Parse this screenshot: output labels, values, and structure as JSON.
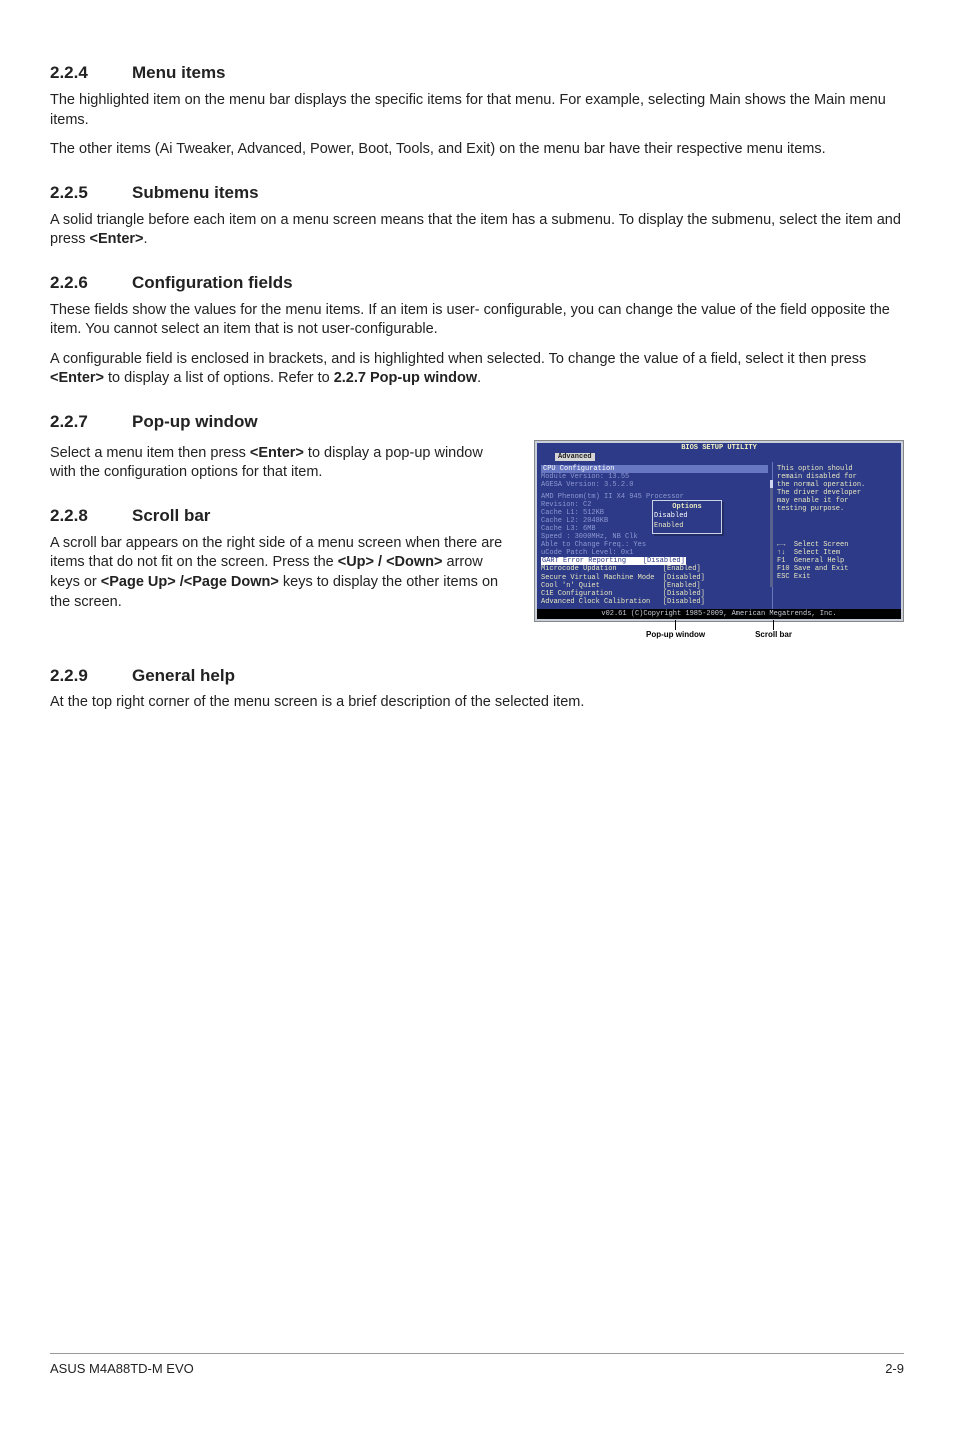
{
  "sections": {
    "s224": {
      "num": "2.2.4",
      "title": "Menu items",
      "p1": "The highlighted item on the menu bar displays the specific items for that menu. For example, selecting Main shows the Main menu items.",
      "p2": "The other items (Ai Tweaker, Advanced, Power, Boot, Tools, and Exit) on the menu bar have their respective menu items."
    },
    "s225": {
      "num": "2.2.5",
      "title": "Submenu items",
      "p1_a": "A solid triangle before each item on a menu screen means that the item has a submenu. To display the submenu, select the item and press ",
      "p1_b": "<Enter>",
      "p1_c": "."
    },
    "s226": {
      "num": "2.2.6",
      "title": "Configuration fields",
      "p1": "These fields show the values for the menu items. If an item is user- configurable, you can change the value of the field opposite the item. You cannot select an item that is not user-configurable.",
      "p2_a": "A configurable field is enclosed in brackets, and is highlighted when selected. To change the value of a field, select it then press ",
      "p2_b": "<Enter>",
      "p2_c": " to display a list of options. Refer to ",
      "p2_d": "2.2.7 Pop-up window",
      "p2_e": "."
    },
    "s227": {
      "num": "2.2.7",
      "title": "Pop-up window",
      "p1_a": "Select a menu item then press ",
      "p1_b": "<Enter>",
      "p1_c": " to display a pop-up window with the configuration options for that item."
    },
    "s228": {
      "num": "2.2.8",
      "title": "Scroll bar",
      "p1_a": "A scroll bar appears on the right side of a menu screen when there are items that do not fit on the screen. Press the ",
      "p1_b": "<Up> / <Down>",
      "p1_c": " arrow keys or ",
      "p1_d": "<Page Up> /<Page Down>",
      "p1_e": " keys to display the other items on the screen."
    },
    "s229": {
      "num": "2.2.9",
      "title": "General help",
      "p1": "At the top right corner of the menu screen is a brief description of the selected item."
    }
  },
  "bios": {
    "title": "BIOS SETUP UTILITY",
    "tab": "Advanced",
    "left": {
      "header": "CPU Configuration",
      "mversion": "Module Version: 13.55",
      "aversion": "AGESA Version: 3.5.2.0",
      "cpu": "AMD Phenom(tm) II X4 945 Processor",
      "rev": "Revision: C2",
      "l1": "Cache L1: 512KB",
      "l2": "Cache L2: 2048KB",
      "l3": "Cache L3: 6MB",
      "speed": "Speed : 3000MHz,  NB Clk",
      "able": "Able to Change Freq.: Yes",
      "ucode": "uCode Patch Level: 0x1",
      "hl": "GART Error Reporting",
      "hl_val": "[Disabled]",
      "items": [
        {
          "name": "Microcode Updation",
          "val": "[Enabled]"
        },
        {
          "name": "Secure Virtual Machine Mode",
          "val": "[Disabled]"
        },
        {
          "name": "Cool 'n' Quiet",
          "val": "[Enabled]"
        },
        {
          "name": "C1E Configuration",
          "val": "[Disabled]"
        },
        {
          "name": "Advanced Clock Calibration",
          "val": "[Disabled]"
        }
      ]
    },
    "right": {
      "help": [
        "This option should",
        "remain disabled for",
        "the normal operation.",
        "The driver developer",
        "may enable it for",
        "testing purpose."
      ],
      "nav": [
        {
          "k": "←→",
          "v": "Select Screen"
        },
        {
          "k": "↑↓",
          "v": "Select Item"
        },
        {
          "k": "F1",
          "v": "General Help"
        },
        {
          "k": "F10",
          "v": "Save and Exit"
        },
        {
          "k": "ESC",
          "v": "Exit"
        }
      ]
    },
    "popup": {
      "title": "Options",
      "opt1": "Disabled",
      "opt2": "Enabled"
    },
    "footer": "v02.61 (C)Copyright 1985-2009, American Megatrends, Inc.",
    "callout_popup": "Pop-up window",
    "callout_scroll": "Scroll bar"
  },
  "footer": {
    "left": "ASUS M4A88TD-M EVO",
    "right": "2-9"
  }
}
